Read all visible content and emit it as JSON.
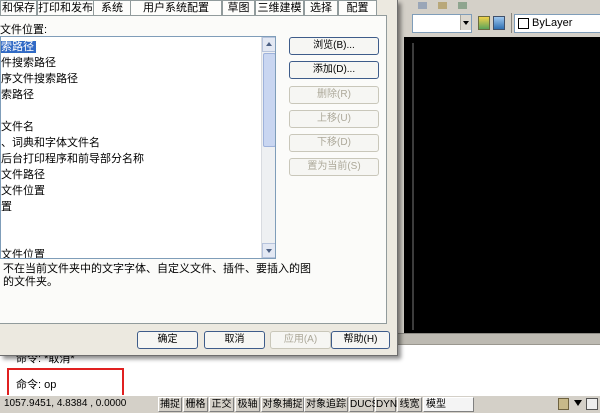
{
  "dialog": {
    "tabs": [
      "和保存",
      "打印和发布",
      "系统",
      "用户系统配置",
      "草图",
      "三维建模",
      "选择",
      "配置"
    ],
    "list_label": "文件位置:",
    "tree_items": [
      "索路径",
      "件搜索路径",
      "序文件搜索路径",
      "索路径",
      "",
      "文件名",
      "、词典和字体文件名",
      "后台打印程序和前导部分名称",
      "文件路径",
      "文件位置",
      "置",
      "",
      "",
      "文件位置"
    ],
    "selected_index": 0,
    "side_buttons": [
      {
        "label": "浏览(B)...",
        "enabled": true
      },
      {
        "label": "添加(D)...",
        "enabled": true
      },
      {
        "label": "删除(R)",
        "enabled": false
      },
      {
        "label": "上移(U)",
        "enabled": false
      },
      {
        "label": "下移(D)",
        "enabled": false
      },
      {
        "label": "置为当前(S)",
        "enabled": false
      }
    ],
    "description": [
      "不在当前文件夹中的文字字体、自定义文件、插件、要插入的图",
      "的文件夹。"
    ],
    "footer_buttons": [
      {
        "label": "确定",
        "enabled": true
      },
      {
        "label": "取消",
        "enabled": true
      },
      {
        "label": "应用(A)",
        "enabled": false
      },
      {
        "label": "帮助(H)",
        "enabled": true
      }
    ]
  },
  "app": {
    "linetype_dropdown": "ByLayer",
    "command_history": "命令: *取消*",
    "command_current": "命令: op",
    "coordinates": "1057.9451, 4.8384 , 0.0000",
    "status_toggles": [
      "捕捉",
      "栅格",
      "正交",
      "极轴",
      "对象捕捉",
      "对象追踪",
      "DUCS",
      "DYN",
      "线宽",
      "模型"
    ],
    "highlight_color": "#e02020",
    "selection_color": "#316ac5"
  }
}
